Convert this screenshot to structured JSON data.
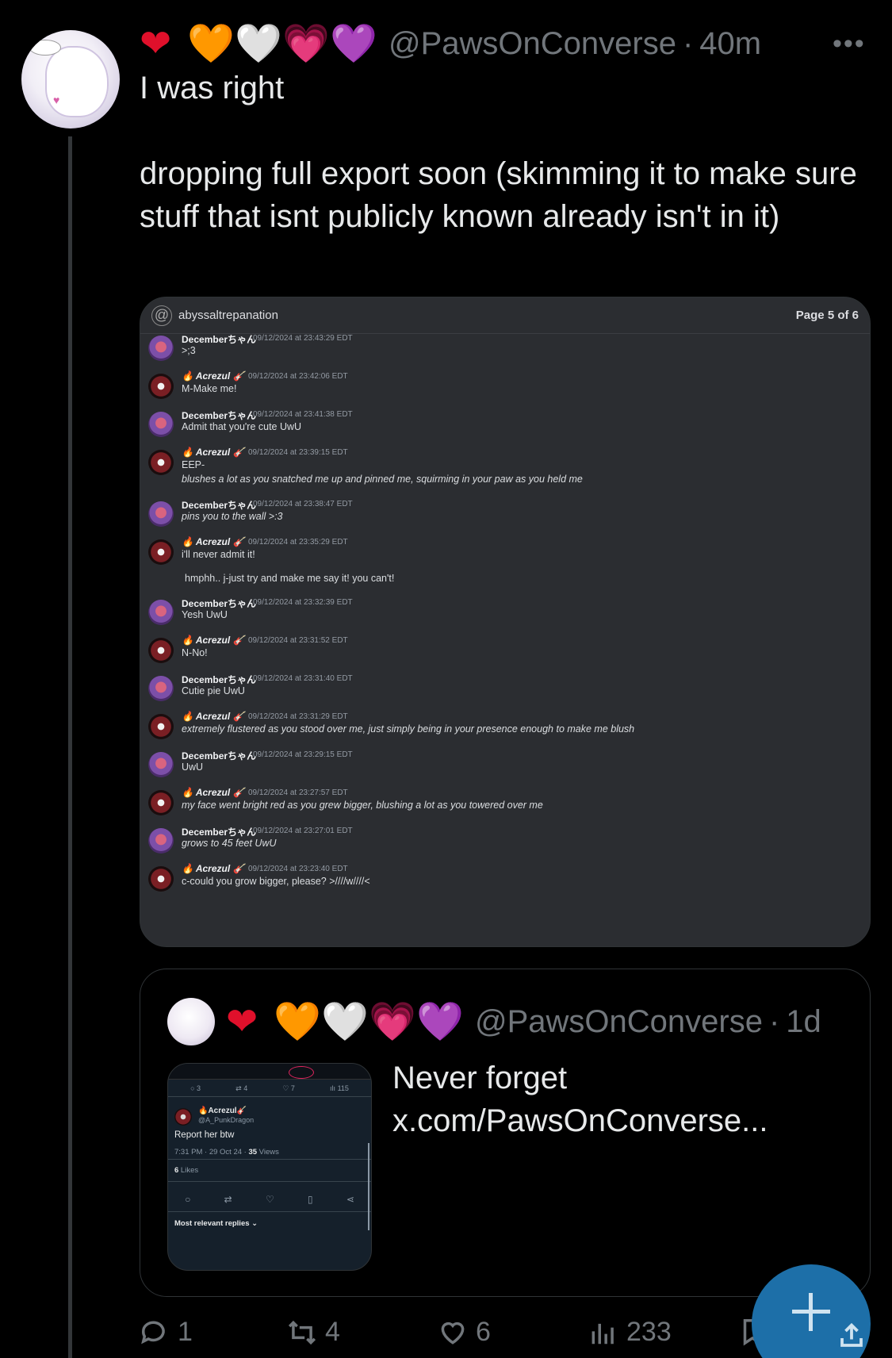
{
  "tweet": {
    "emojis": [
      "❤",
      "🧡",
      "🤍",
      "💗",
      "💜"
    ],
    "handle": "@PawsOnConverse",
    "separator": "·",
    "time": "40m",
    "more": "•••",
    "line1": "I was right",
    "line2": "dropping full export soon (skimming it to make sure stuff that isnt publicly known already isn't in it)"
  },
  "media": {
    "channel": "abyssaltrepanation",
    "at_symbol": "@",
    "page": "Page 5 of 6",
    "messages": [
      {
        "who": "dec",
        "name": "Decemberちゃん",
        "ts": "09/12/2024 at 23:43:29 EDT",
        "body": ">;3"
      },
      {
        "who": "acr",
        "name": "🔥 Acrezul 🎸",
        "ts": "09/12/2024 at 23:42:06 EDT",
        "body": "M-Make me!"
      },
      {
        "who": "dec",
        "name": "Decemberちゃん",
        "ts": "09/12/2024 at 23:41:38 EDT",
        "body": "Admit that you're cute UwU"
      },
      {
        "who": "acr",
        "name": "🔥 Acrezul 🎸",
        "ts": "09/12/2024 at 23:39:15 EDT",
        "body": "EEP-",
        "body2": "blushes a lot as you snatched me up and pinned me, squirming in your paw as you held me"
      },
      {
        "who": "dec",
        "name": "Decemberちゃん",
        "ts": "09/12/2024 at 23:38:47 EDT",
        "body": "pins you to the wall >:3",
        "italic": true
      },
      {
        "who": "acr",
        "name": "🔥 Acrezul 🎸",
        "ts": "09/12/2024 at 23:35:29 EDT",
        "body": "i'll never admit it!",
        "body3": "hmphh.. j-just try and make me say it! you can't!"
      },
      {
        "who": "dec",
        "name": "Decemberちゃん",
        "ts": "09/12/2024 at 23:32:39 EDT",
        "body": "Yesh UwU"
      },
      {
        "who": "acr",
        "name": "🔥 Acrezul 🎸",
        "ts": "09/12/2024 at 23:31:52 EDT",
        "body": "N-No!"
      },
      {
        "who": "dec",
        "name": "Decemberちゃん",
        "ts": "09/12/2024 at 23:31:40 EDT",
        "body": "Cutie pie UwU"
      },
      {
        "who": "acr",
        "name": "🔥 Acrezul 🎸",
        "ts": "09/12/2024 at 23:31:29 EDT",
        "body": "extremely flustered as you stood over me, just simply being in your presence enough to make me blush",
        "italic": true
      },
      {
        "who": "dec",
        "name": "Decemberちゃん",
        "ts": "09/12/2024 at 23:29:15 EDT",
        "body": "UwU"
      },
      {
        "who": "acr",
        "name": "🔥 Acrezul 🎸",
        "ts": "09/12/2024 at 23:27:57 EDT",
        "body": "my face went bright red as you grew bigger, blushing a lot as you towered over me",
        "italic": true
      },
      {
        "who": "dec",
        "name": "Decemberちゃん",
        "ts": "09/12/2024 at 23:27:01 EDT",
        "body": "grows to 45 feet UwU",
        "italic": true
      },
      {
        "who": "acr",
        "name": "🔥 Acrezul 🎸",
        "ts": "09/12/2024 at 23:23:40 EDT",
        "body": "c-could you grow bigger, please? >////w////<"
      }
    ]
  },
  "quote": {
    "emojis": [
      "❤",
      "🧡",
      "🤍",
      "💗",
      "💜"
    ],
    "handle": "@PawsOnConverse",
    "separator": "·",
    "time": "1d",
    "text": "Never forget x.com/PawsOnConverse...",
    "thumb": {
      "stats": [
        "3",
        "4",
        "7",
        "115"
      ],
      "name": "🔥Acrezul🎸",
      "handle": "@A_PunkDragon",
      "body": "Report her btw",
      "meta_time": "7:31 PM · 29 Oct 24 · ",
      "meta_views": "35",
      "meta_views_label": " Views",
      "likes_count": "6",
      "likes_label": " Likes",
      "replies": "Most relevant replies ⌄"
    }
  },
  "actions": {
    "replies": "1",
    "retweets": "4",
    "likes": "6",
    "views": "233"
  },
  "colors": {
    "background": "#000000",
    "text": "#e7e9ea",
    "muted": "#71767b",
    "fab": "#1d6fa8"
  }
}
